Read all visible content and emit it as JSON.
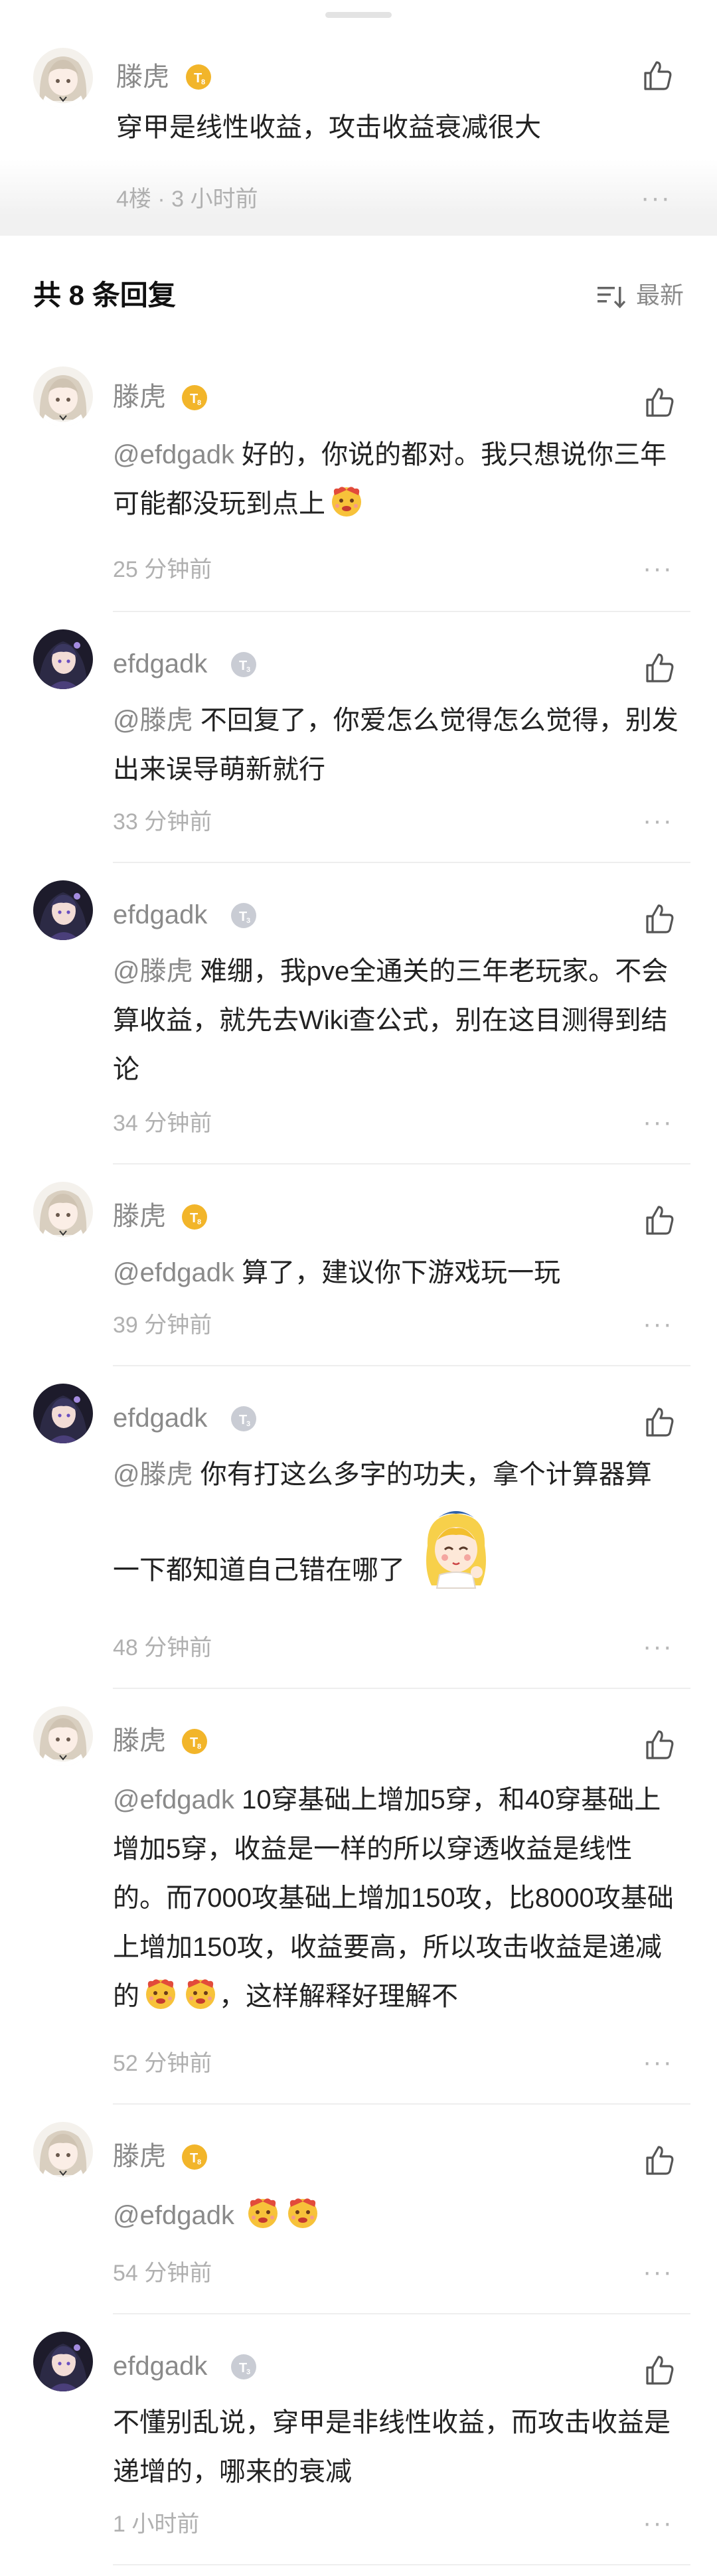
{
  "original_comment": {
    "author": "滕虎",
    "text": "穿甲是线性收益，攻击收益衰减很大",
    "meta": "4楼 · 3 小时前"
  },
  "replies_header": {
    "count_label": "共 8 条回复",
    "sort_label": "最新"
  },
  "replies": [
    {
      "author": "滕虎",
      "mention": "@efdgadk",
      "text_1": " 好的，你说的都对。我只想说你三年可能都没玩到点上",
      "time": "25 分钟前"
    },
    {
      "author": "efdgadk",
      "mention": "@滕虎",
      "text_1": " 不回复了，你爱怎么觉得怎么觉得，别发出来误导萌新就行",
      "time": "33 分钟前"
    },
    {
      "author": "efdgadk",
      "mention": "@滕虎",
      "text_1": " 难绷，我pve全通关的三年老玩家。不会算收益，就先去Wiki查公式，别在这目测得到结论",
      "time": "34 分钟前"
    },
    {
      "author": "滕虎",
      "mention": "@efdgadk",
      "text_1": " 算了，建议你下游戏玩一玩",
      "time": "39 分钟前"
    },
    {
      "author": "efdgadk",
      "mention": "@滕虎",
      "text_1": " 你有打这么多字的功夫，拿个计算器算",
      "text_2": "一下都知道自己错在哪了",
      "time": "48 分钟前"
    },
    {
      "author": "滕虎",
      "mention": "@efdgadk",
      "text_1": " 10穿基础上增加5穿，和40穿基础上增加5穿，收益是一样的所以穿透收益是线性的。而7000攻基础上增加150攻，比8000攻基础上增加150攻，收益要高，所以攻击收益是递减的",
      "text_2": "，这样解释好理解不",
      "time": "52 分钟前"
    },
    {
      "author": "滕虎",
      "mention": "@efdgadk",
      "time": "54 分钟前"
    },
    {
      "author": "efdgadk",
      "text_1": "不懂别乱说，穿甲是非线性收益，而攻击收益是递增的，哪来的衰减",
      "time": "1 小时前"
    }
  ],
  "more_glyph": "···",
  "colors": {
    "gold_badge": "#f2b52a",
    "gray_badge": "#c9ccd4",
    "meta_text": "#b0b0b0",
    "name_text": "#8a8a8a"
  }
}
